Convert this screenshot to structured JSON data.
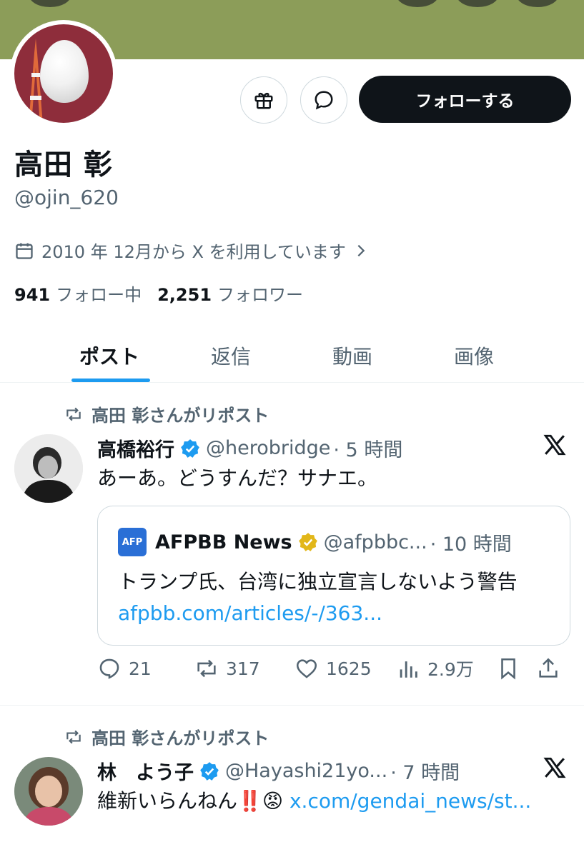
{
  "profile": {
    "name": "高田 彰",
    "handle": "@ojin_620",
    "joined": "2010 年 12月から X を利用しています",
    "following_count": "941",
    "following_label": "フォロー中",
    "followers_count": "2,251",
    "followers_label": "フォロワー",
    "follow_button": "フォローする"
  },
  "tabs": [
    {
      "label": "ポスト",
      "active": true
    },
    {
      "label": "返信",
      "active": false
    },
    {
      "label": "動画",
      "active": false
    },
    {
      "label": "画像",
      "active": false
    }
  ],
  "posts": [
    {
      "repost_label": "高田 彰さんがリポスト",
      "author_name": "高橋裕行",
      "author_handle": "@herobridge",
      "time": "· 5 時間",
      "text": "あーあ。どうすんだ？サナエ。",
      "quote": {
        "logo_text": "AFP",
        "author_name": "AFPBB News",
        "author_handle": "@afpbbc...",
        "time": "· 10 時間",
        "text": "トランプ氏、台湾に独立宣言しないよう警告",
        "link": "afpbb.com/articles/-/363..."
      },
      "replies": "21",
      "reposts": "317",
      "likes": "1625",
      "views": "2.9万"
    },
    {
      "repost_label": "高田 彰さんがリポスト",
      "author_name": "林　よう子",
      "author_handle": "@Hayashi21yo...",
      "time": "· 7 時間",
      "text": "維新いらんねん‼️😡 ",
      "link": "x.com/gendai_news/st..."
    }
  ],
  "colors": {
    "banner": "#8c9d59",
    "accent": "#1d9bf0",
    "verified_blue": "#1d9bf0",
    "verified_gold": "#e2b719"
  }
}
